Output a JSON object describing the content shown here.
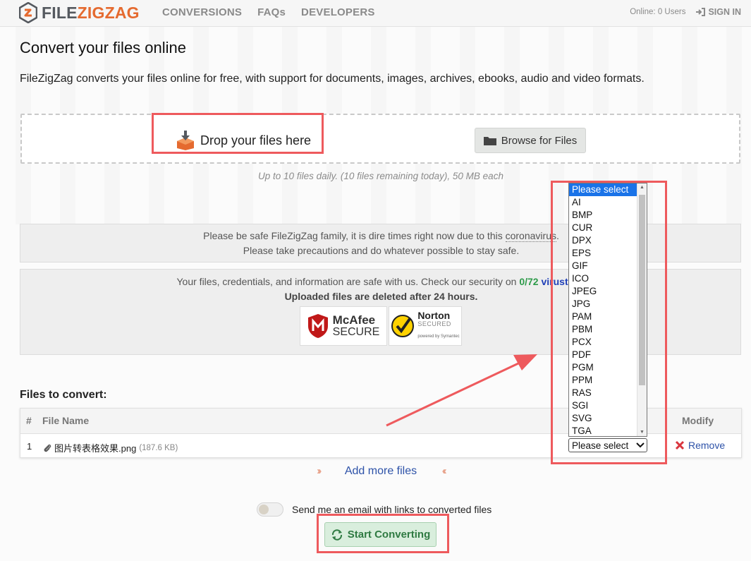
{
  "header": {
    "brand_part1": "FILE",
    "brand_part2": "ZIGZAG",
    "nav": [
      "CONVERSIONS",
      "FAQs",
      "DEVELOPERS"
    ],
    "online": "Online: 0 Users",
    "sign_in": "SIGN IN"
  },
  "main": {
    "title": "Convert your files online",
    "intro": "FileZigZag converts your files online for free, with support for documents, images, archives, ebooks, audio and video formats.",
    "drop_label": "Drop your files here",
    "browse_label": "Browse for Files",
    "limits": "Up to 10 files daily. (10 files remaining today), 50 MB each"
  },
  "notice": {
    "line1_before": "Please be safe FileZigZag family, it is dire times right now due to this ",
    "line1_link": "coronavirus",
    "line1_after": ".",
    "line2": "Please take precautions and do whatever possible to stay safe."
  },
  "security": {
    "line1_before": "Your files, credentials, and information are safe with us. Check our security on ",
    "score": "0/72",
    "virustotal": "virustotal",
    "line2": "Uploaded files are deleted after 24 hours.",
    "mcafee_brand": "McAfee",
    "mcafee_sub": "SECURE",
    "norton_brand": "Norton",
    "norton_sub": "SECURED",
    "norton_powered": "powered by Symantec"
  },
  "files": {
    "title": "Files to convert:",
    "headers": {
      "num": "#",
      "name": "File Name",
      "modify": "Modify"
    },
    "rows": [
      {
        "num": "1",
        "name": "图片转表格效果.png",
        "size": "(187.6 KB)",
        "select": "Please select",
        "remove": "Remove"
      }
    ],
    "add_more": "Add more files"
  },
  "email_option": "Send me an email with links to converted files",
  "start_button": "Start Converting",
  "format_dropdown": {
    "options": [
      "Please select",
      "AI",
      "BMP",
      "CUR",
      "DPX",
      "EPS",
      "GIF",
      "ICO",
      "JPEG",
      "JPG",
      "PAM",
      "PBM",
      "PCX",
      "PDF",
      "PGM",
      "PPM",
      "RAS",
      "SGI",
      "SVG",
      "TGA"
    ],
    "selected": "Please select"
  },
  "colors": {
    "brand_orange": "#e56a2f",
    "brand_gray": "#55595f",
    "annotation_red": "#ee5a5d",
    "link_blue": "#2d52a8",
    "start_green": "#2f7a42",
    "dropdown_highlight": "#1a73e8"
  }
}
